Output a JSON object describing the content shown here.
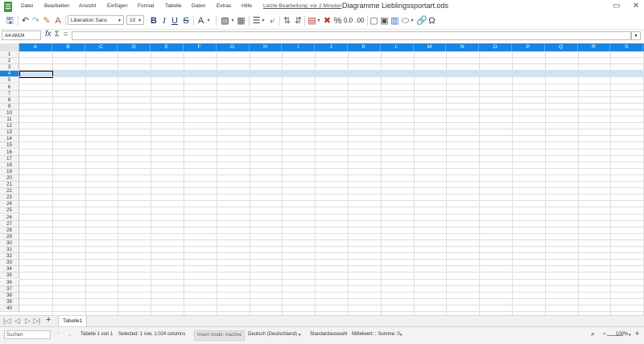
{
  "menubar": {
    "items": [
      "Datei",
      "Bearbeiten",
      "Ansicht",
      "Einfügen",
      "Format",
      "Tabelle",
      "Daten",
      "Extras",
      "Hilfe"
    ],
    "last_edit": "Letzte Bearbeitung: vor 2 Minuten",
    "document_title": "Diagramme Lieblingssportart.ods"
  },
  "toolbar": {
    "font_name": "Liberation Sans",
    "font_size": "10"
  },
  "formula": {
    "name_box": "A4:AMJ4",
    "fx": "fx",
    "sigma": "Σ",
    "equals": "="
  },
  "grid": {
    "columns": [
      "A",
      "B",
      "C",
      "D",
      "E",
      "F",
      "G",
      "H",
      "I",
      "J",
      "K",
      "L",
      "M",
      "N",
      "O",
      "P",
      "Q",
      "R",
      "S"
    ],
    "rows": [
      "1",
      "2",
      "3",
      "4",
      "5",
      "6",
      "7",
      "8",
      "9",
      "10",
      "11",
      "12",
      "13",
      "14",
      "15",
      "16",
      "17",
      "18",
      "19",
      "20",
      "21",
      "22",
      "23",
      "24",
      "25",
      "26",
      "27",
      "28",
      "29",
      "30",
      "31",
      "32",
      "33",
      "34",
      "35",
      "36",
      "37",
      "38",
      "39",
      "40"
    ],
    "selected_row": "4",
    "colors": {
      "header": "#1a84e4",
      "selection": "#cfe3f6"
    }
  },
  "tabs": {
    "sheets": [
      "Tabelle1"
    ],
    "add": "+"
  },
  "statusbar": {
    "search_placeholder": "Suchen",
    "sheet_info": "Tabelle 1 von 1",
    "selection_info": "Selected: 1 row, 1,024 columns",
    "insert_mode": "Insert mode: inactive",
    "language": "Deutsch (Deutschland)",
    "selection_mode": "Standardauswahl",
    "summary": "Mittelwert: ; Summe: 0",
    "zoom": "100%"
  }
}
